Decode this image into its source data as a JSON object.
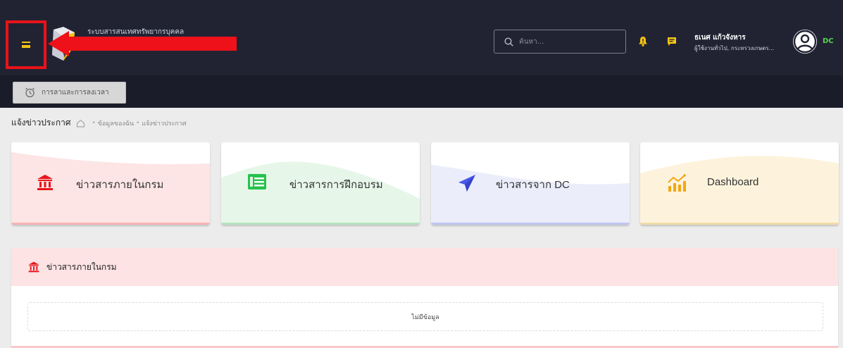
{
  "header": {
    "app_title": "ระบบสารสนเทศทรัพยากรบุคคล",
    "search_placeholder": "ค้นหา...",
    "user_name": "ธเนศ แก้วจังหาร",
    "user_role": "ผู้ใช้งานทั่วไป, กระทรวงเกษตร...",
    "org_code": "DC",
    "icons": {
      "menu": "hamburger-icon",
      "search": "search-icon",
      "notification": "bell-warning-icon",
      "message": "chat-icon",
      "avatar": "user-circle-icon"
    },
    "colors": {
      "background": "#212333",
      "accent": "#f3c413",
      "highlight_box": "#e8141a",
      "org_code": "#53d94a"
    }
  },
  "subbar": {
    "attendance_button": "การลาและการลงเวลา",
    "attendance_icon": "alarm-clock-icon"
  },
  "breadcrumb": {
    "title": "แจ้งข่าวประกาศ",
    "home_icon": "home-icon",
    "items": [
      "ข้อมูลของฉัน",
      "แจ้งข่าวประกาศ"
    ]
  },
  "cards": [
    {
      "label": "ข่าวสารภายในกรม",
      "icon": "bank-icon",
      "color": "#e8141a"
    },
    {
      "label": "ข่าวสารการฝึกอบรม",
      "icon": "newspaper-icon",
      "color": "#27c24c"
    },
    {
      "label": "ข่าวสารจาก DC",
      "icon": "paper-plane-icon",
      "color": "#4a58e8"
    },
    {
      "label": "Dashboard",
      "icon": "bar-chart-icon",
      "color": "#f3a712"
    }
  ],
  "panel": {
    "title": "ข่าวสารภายในกรม",
    "icon": "bank-icon",
    "empty_text": "ไม่มีข้อมูล"
  }
}
